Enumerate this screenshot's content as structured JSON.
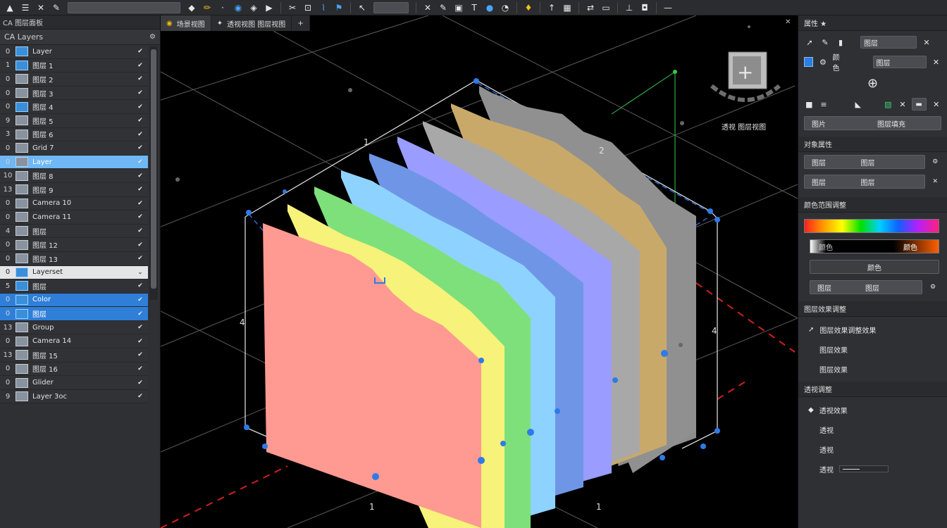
{
  "toolbar": {
    "icons": [
      "triangle-icon",
      "menu-icon",
      "pin-icon",
      "pen-icon",
      "field",
      "sphere-icon",
      "tag-icon",
      "dot-icon",
      "globe-icon",
      "sep",
      "bookmark-icon",
      "play-icon",
      "sep",
      "scissors-icon",
      "crop-icon",
      "brush-icon",
      "flag-icon",
      "sep",
      "cursor-icon",
      "field-small",
      "sep",
      "x-icon",
      "pencil-icon",
      "frame-icon",
      "text-icon",
      "globe2-icon",
      "gauge-icon",
      "sep",
      "bulb-icon",
      "sep",
      "arrow-icon",
      "grid-icon",
      "sep",
      "pair-icon",
      "monitor-icon",
      "sep",
      "measure-icon",
      "camera-icon",
      "sep",
      "minus-icon"
    ]
  },
  "left_panel": {
    "window_title": "CA 图层面板",
    "header_title": "CA Layers",
    "header_icon": "gear-icon",
    "layers": [
      {
        "idx": "0",
        "name": "Layer",
        "state": "normal",
        "thumb": "blue"
      },
      {
        "idx": "1",
        "name": "图层 1",
        "state": "normal",
        "thumb": "blue"
      },
      {
        "idx": "0",
        "name": "图层 2",
        "state": "normal",
        "thumb": "gray"
      },
      {
        "idx": "0",
        "name": "图层 3",
        "state": "normal",
        "thumb": "gray"
      },
      {
        "idx": "0",
        "name": "图层 4",
        "state": "normal",
        "thumb": "blue"
      },
      {
        "idx": "9",
        "name": "图层 5",
        "state": "normal",
        "thumb": "gray"
      },
      {
        "idx": "3",
        "name": "图层 6",
        "state": "normal",
        "thumb": "gray"
      },
      {
        "idx": "0",
        "name": "Grid 7",
        "state": "normal",
        "thumb": "gray"
      },
      {
        "idx": "0",
        "name": "Layer",
        "state": "sel-light",
        "thumb": "gray"
      },
      {
        "idx": "10",
        "name": "图层 8",
        "state": "normal",
        "thumb": "gray"
      },
      {
        "idx": "13",
        "name": "图层 9",
        "state": "normal",
        "thumb": "gray"
      },
      {
        "idx": "0",
        "name": "Camera 10",
        "state": "normal",
        "thumb": "gray"
      },
      {
        "idx": "0",
        "name": "Camera 11",
        "state": "normal",
        "thumb": "gray"
      },
      {
        "idx": "4",
        "name": "图层",
        "state": "normal",
        "thumb": "gray"
      },
      {
        "idx": "0",
        "name": "图层 12",
        "state": "normal",
        "thumb": "gray"
      },
      {
        "idx": "0",
        "name": "图层 13",
        "state": "normal",
        "thumb": "gray"
      },
      {
        "idx": "0",
        "name": "Layerset",
        "state": "group",
        "thumb": "blue"
      },
      {
        "idx": "5",
        "name": "图层",
        "state": "normal",
        "thumb": "blue"
      },
      {
        "idx": "0",
        "name": "Color",
        "state": "sel-blue",
        "thumb": "blue"
      },
      {
        "idx": "0",
        "name": "图层",
        "state": "sel-blue",
        "thumb": "blue"
      },
      {
        "idx": "13",
        "name": "Group",
        "state": "normal",
        "thumb": "gray"
      },
      {
        "idx": "0",
        "name": "Camera 14",
        "state": "normal",
        "thumb": "gray"
      },
      {
        "idx": "13",
        "name": "图层 15",
        "state": "normal",
        "thumb": "gray"
      },
      {
        "idx": "0",
        "name": "图层 16",
        "state": "normal",
        "thumb": "gray"
      },
      {
        "idx": "0",
        "name": "Glider",
        "state": "normal",
        "thumb": "gray"
      },
      {
        "idx": "9",
        "name": "Layer 3oc",
        "state": "normal",
        "thumb": "gray"
      }
    ]
  },
  "viewport": {
    "tabs": [
      {
        "label": "场景视图",
        "icon": "chrome-icon"
      },
      {
        "label": "透视视图 图层视图",
        "icon": "arrow-icon"
      }
    ],
    "add_tab": "+",
    "gizmo_label": "透视 图层视图",
    "labels": {
      "a": "1",
      "b": "2",
      "c": "4",
      "d": "4",
      "e": "1",
      "f": "1"
    }
  },
  "right_panel": {
    "title": "属性 ★",
    "row1": {
      "field": "图层"
    },
    "row2": {
      "label": "颜色",
      "field": "图层"
    },
    "row3_button": {
      "left": "图片",
      "right": "图层填充"
    },
    "section1": "对象属性",
    "btn1": {
      "left": "图层",
      "right": "图层"
    },
    "btn2": {
      "left": "图层",
      "right": "图层"
    },
    "section2": "颜色范围调整",
    "grad2_label": "颜色",
    "grad2_right": "颜色",
    "btn3": "颜色",
    "btn4": {
      "left": "图层",
      "right": "图层"
    },
    "section3": "图层效果调整",
    "list1": [
      "图层效果调整效果",
      "图层效果",
      "图层效果"
    ],
    "section4": "透视调整",
    "list2": [
      "透视效果",
      "透视",
      "透视",
      "透视"
    ]
  }
}
